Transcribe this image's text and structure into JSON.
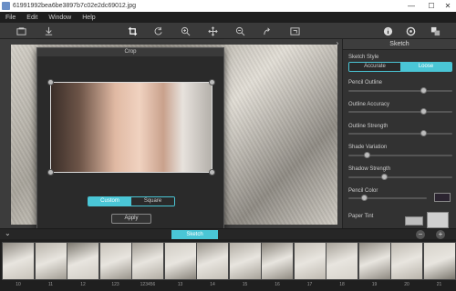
{
  "window": {
    "title": "61991992bea6be3897b7c02e2dc69012.jpg",
    "minimize": "—",
    "maximize": "☐",
    "close": "✕"
  },
  "menu": {
    "items": [
      "File",
      "Edit",
      "Window",
      "Help"
    ]
  },
  "toolbar": {
    "tools": [
      "open-icon",
      "save-icon",
      "crop-icon",
      "rotate-icon",
      "zoom-in-icon",
      "pan-icon",
      "zoom-out-icon",
      "redo-icon",
      "fit-icon",
      "info-icon",
      "settings-icon",
      "effects-icon"
    ]
  },
  "crop": {
    "title": "Crop",
    "mode_custom": "Custom",
    "mode_square": "Square",
    "apply": "Apply"
  },
  "panel": {
    "title": "Sketch",
    "collapse_glyph": "›",
    "style_label": "Sketch Style",
    "style_accurate": "Accurate",
    "style_loose": "Loose",
    "sliders": [
      {
        "label": "Pencil Outline",
        "value": 0.72
      },
      {
        "label": "Outline Accuracy",
        "value": 0.72
      },
      {
        "label": "Outline Strength",
        "value": 0.72
      },
      {
        "label": "Shade Variation",
        "value": 0.18
      },
      {
        "label": "Shadow Strength",
        "value": 0.35
      },
      {
        "label": "Pencil Color",
        "value": 0.2
      }
    ],
    "paper_tint_label": "Paper Tint",
    "colors": {
      "pencil_color": "#2b2430",
      "paper_tint": "#bdbdbd",
      "accent": "#4ac6d6"
    }
  },
  "filmstrip": {
    "tab_label": "Sketch",
    "collapse_glyph": "⌄",
    "remove_glyph": "−",
    "add_glyph": "+",
    "thumbnails": [
      {
        "num": "10"
      },
      {
        "num": "11"
      },
      {
        "num": "12"
      },
      {
        "num": "123"
      },
      {
        "num": "123456"
      },
      {
        "num": "13"
      },
      {
        "num": "14"
      },
      {
        "num": "15"
      },
      {
        "num": "16"
      },
      {
        "num": "17"
      },
      {
        "num": "18"
      },
      {
        "num": "19"
      },
      {
        "num": "20"
      },
      {
        "num": "21"
      }
    ]
  }
}
